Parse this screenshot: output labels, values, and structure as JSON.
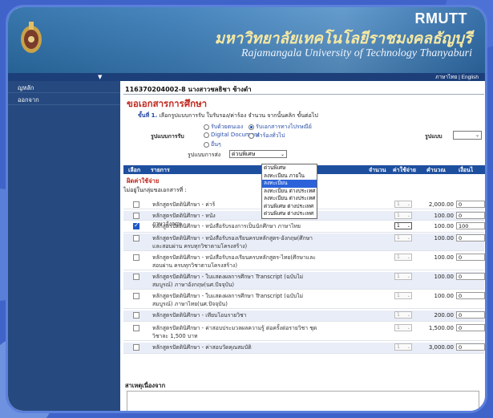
{
  "header": {
    "brand": "RMUTT",
    "thai_name": "มหาวิทยาลัยเทคโนโลยีราชมงคลธัญบุรี",
    "english_name": "Rajamangala University of Technology Thanyaburi",
    "lang_thai": "ภาษาไทย",
    "lang_sep": "|",
    "lang_english": "English"
  },
  "sidebar": {
    "items": [
      {
        "label": "ญหลัก"
      },
      {
        "label": "ออกจาก"
      }
    ]
  },
  "student_line": "116370204002-8 นางสาวชลธิชา ช้างดำ",
  "page_title": "ขอเอกสารการศึกษา",
  "step": {
    "number": "ขั้นที่ 1.",
    "text": "เลือกรูปแบบการรับ ใบรับรอง/ค่าร้อง จำนวน จากนั้นคลิก ขั้นต่อไป"
  },
  "receive": {
    "label": "รูปแบบการรับ",
    "options": [
      {
        "label": "รับด้วยตนเอง",
        "selected": false
      },
      {
        "label": "รับเอกสารทางไปรษณีย์",
        "selected": true
      },
      {
        "label": "Digital Document",
        "selected": false
      },
      {
        "label": "ค่าร้องทั่วไป",
        "selected": false
      },
      {
        "label": "อื่นๆ",
        "selected": false
      }
    ],
    "format_label": "รูปแบบ",
    "format_value": ""
  },
  "shipping": {
    "label": "รูปแบบการส่ง",
    "selected": "ด่วนพิเศษ",
    "options": [
      {
        "label": "ด่วนพิเศษ",
        "highlight": false
      },
      {
        "label": "ลงทะเบียน ภายใน",
        "highlight": false
      },
      {
        "label": "ลงทะเบียน",
        "highlight": true
      },
      {
        "label": "ลงทะเบียน ต่างประเทศ",
        "highlight": false
      },
      {
        "label": "ลงทะเบียน ต่างประเทศ",
        "highlight": false
      },
      {
        "label": "ด่วนพิเศษ ต่างประเทศ",
        "highlight": false
      },
      {
        "label": "ด่วนพิเศษ ต่างประเทศ",
        "highlight": false
      }
    ]
  },
  "table": {
    "headers": {
      "select": "เลือก",
      "item": "รายการ",
      "qty": "จำนวน",
      "fee": "ค่าใช้จ่าย",
      "amount": "คำนวณ",
      "condition": "เงื่อนไ"
    },
    "section": "ผิดค่าใช้จ่าย",
    "subsection": "ไม่อยู่ในกลุ่มขอเอกสารที่ :",
    "rows": [
      {
        "checked": false,
        "text": "หลักสูตรปัตตินิศึกษา - ค่าร้",
        "qty": "1",
        "fee": "2,000.00",
        "amount": "0"
      },
      {
        "checked": false,
        "text": "หลักสูตรปัตตินิศึกษา - หนัง",
        "text2": "ภาษาอังกฤษ",
        "qty": "1",
        "fee": "100.00",
        "amount": "0"
      },
      {
        "checked": true,
        "text": "หลักสูตรปัตตินิศึกษา - หนังสือรับรองการเป็นนักศึกษา ภาษาไทย",
        "qty": "1",
        "fee": "100.00",
        "amount": "100"
      },
      {
        "checked": false,
        "text": "หลักสูตรปัตตินิศึกษา - หนังสือรับรองเรียนครบหลักสูตร-อังกฤษ(ศึกษา",
        "text2": "และสอบผ่าน ครบทุกวิชาตามโครงสร้าง)",
        "qty": "1",
        "fee": "100.00",
        "amount": "0"
      },
      {
        "checked": false,
        "text": "หลักสูตรปัตตินิศึกษา - หนังสือรับรองเรียนครบหลักสูตร-ไทย(ศึกษาและ",
        "text2": "สอบผ่าน ครบทุกวิชาตามโครงสร้าง)",
        "qty": "1",
        "fee": "100.00",
        "amount": "0"
      },
      {
        "checked": false,
        "text": "หลักสูตรปัตตินิศึกษา - ใบแสดงผลการศึกษา Transcript (ฉบับไม่",
        "text2": "สมบูรณ์) ภาษาอังกฤษ(นศ.ปัจจุบัน)",
        "qty": "1",
        "fee": "100.00",
        "amount": "0"
      },
      {
        "checked": false,
        "text": "หลักสูตรปัตตินิศึกษา - ใบแสดงผลการศึกษา Transcript (ฉบับไม่",
        "text2": "สมบูรณ์) ภาษาไทย(นศ.ปัจจุบัน)",
        "qty": "1",
        "fee": "100.00",
        "amount": "0"
      },
      {
        "checked": false,
        "text": "หลักสูตรปัตตินิศึกษา - เทียบโอนรายวิชา",
        "qty": "1",
        "fee": "200.00",
        "amount": "0"
      },
      {
        "checked": false,
        "text": "หลักสูตรปัตตินิศึกษา - ค่าสอบประมวลผลความรู้ ต่อครั้งต่อรายวิชา ชุด",
        "text2": "วิชาละ 1,500 บาท",
        "qty": "1",
        "fee": "1,500.00",
        "amount": "0"
      },
      {
        "checked": false,
        "text": "หลักสูตรปัตตินิศึกษา - ค่าสอบวัดคุณสมบัติ",
        "qty": "1",
        "fee": "3,000.00",
        "amount": "0"
      }
    ]
  },
  "reason_label": "สาเหตุเนื่องจาก"
}
